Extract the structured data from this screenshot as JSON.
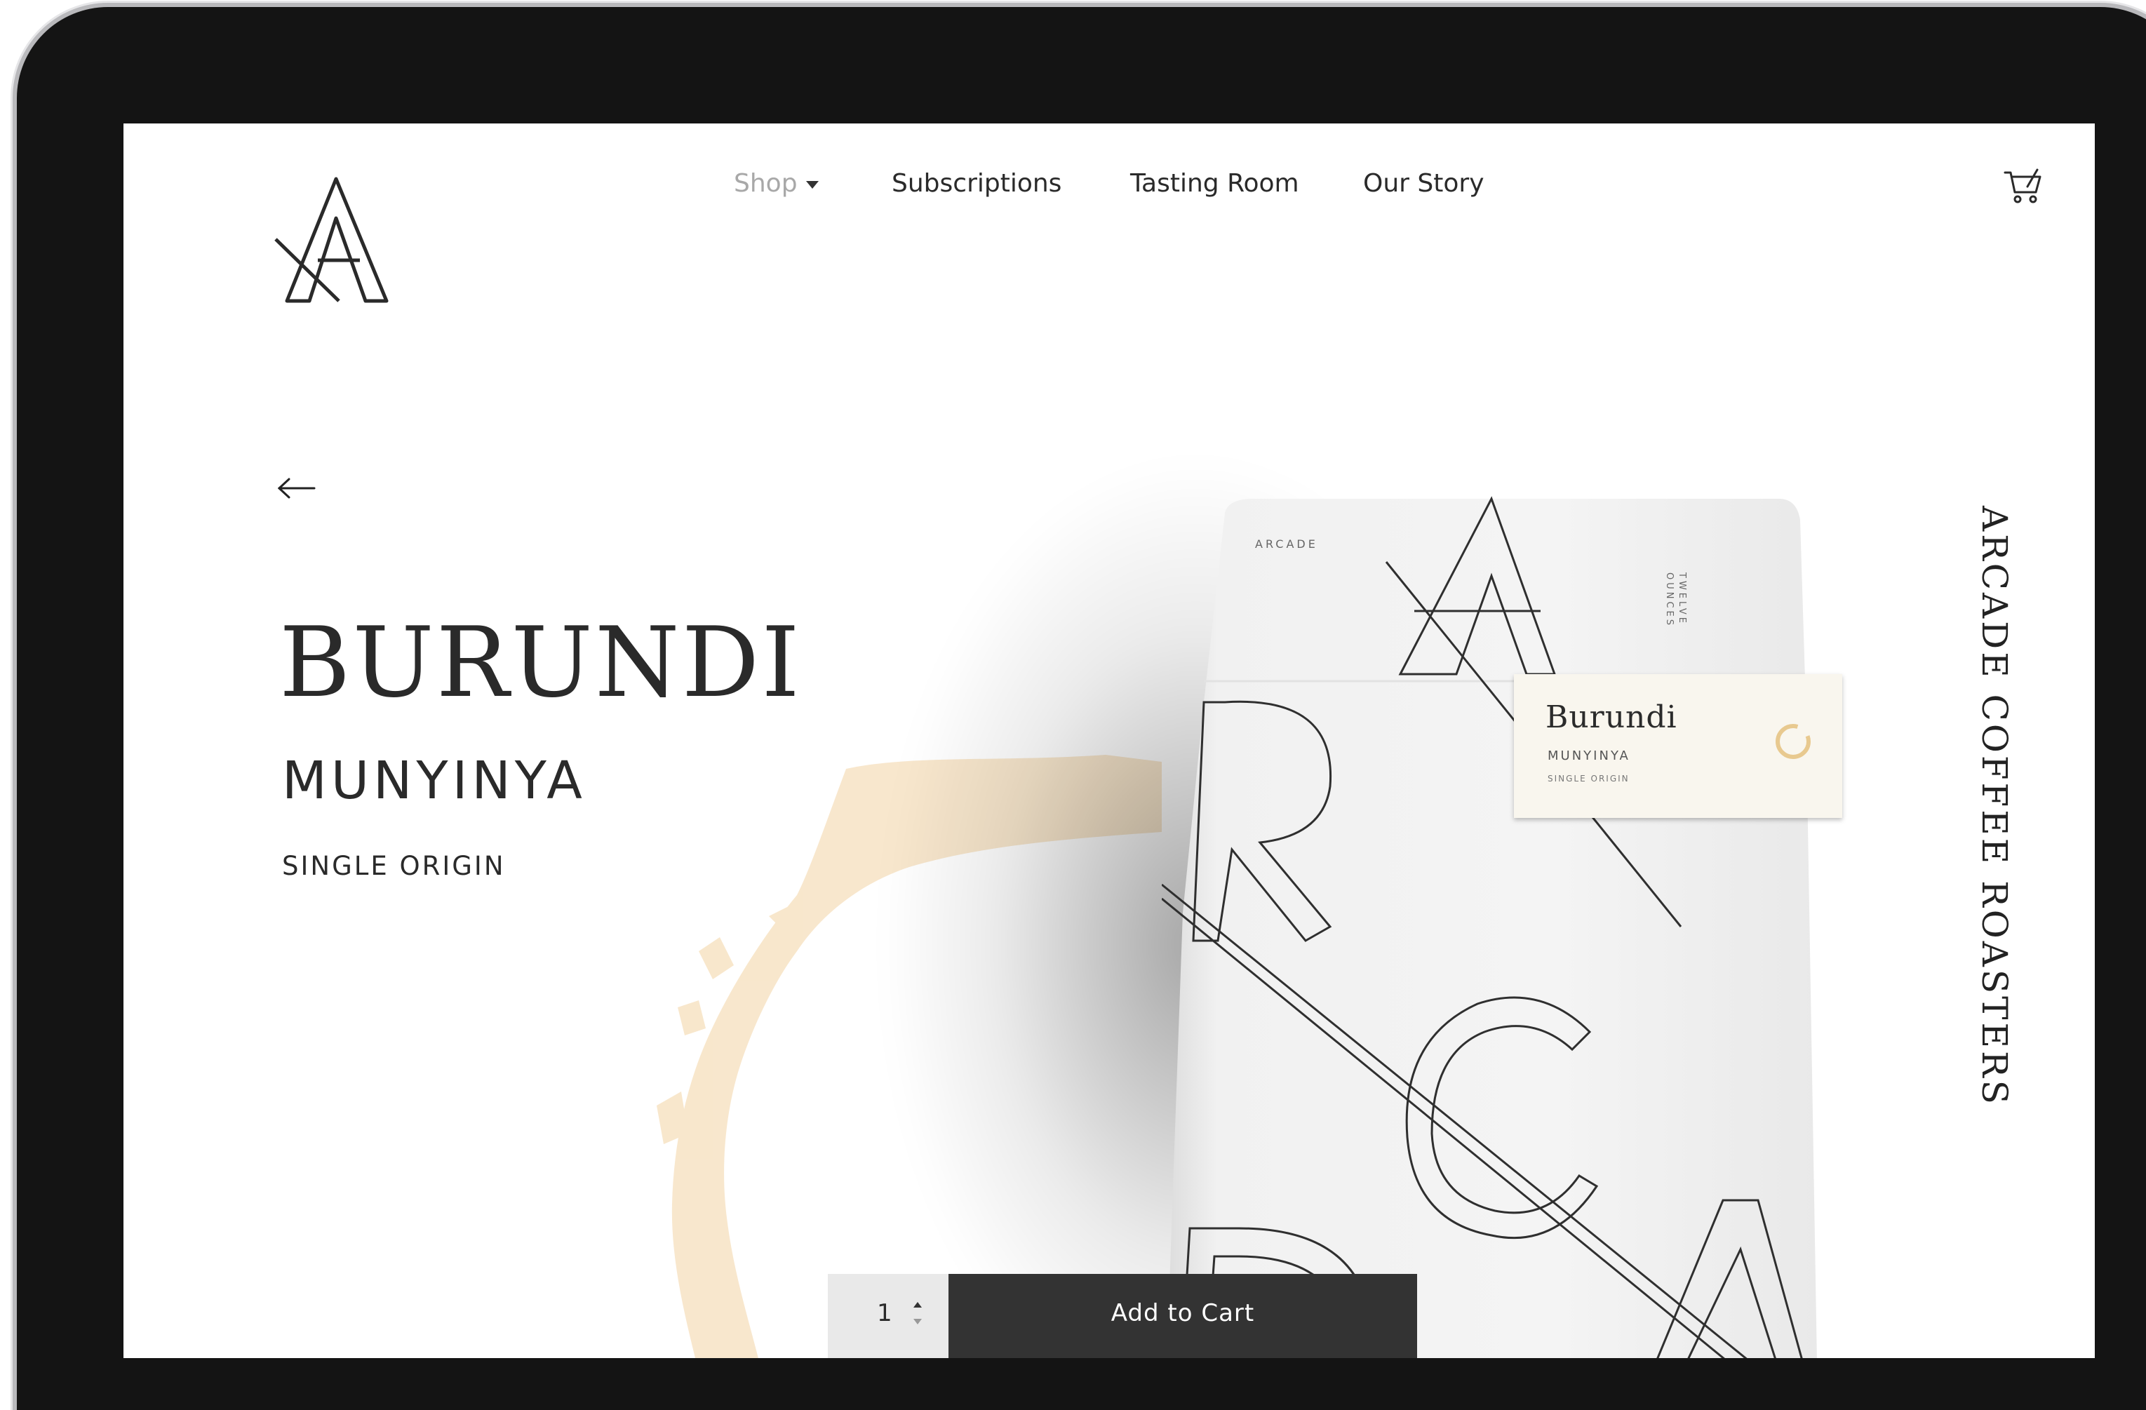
{
  "nav": {
    "items": [
      {
        "label": "Shop",
        "active": true
      },
      {
        "label": "Subscriptions"
      },
      {
        "label": "Tasting Room"
      },
      {
        "label": "Our Story"
      }
    ],
    "cart_icon": "cart-icon",
    "logo_icon": "arcade-a-logo"
  },
  "product": {
    "name": "BURUNDI",
    "farm": "MUNYINYA",
    "type": "SINGLE ORIGIN"
  },
  "bag": {
    "brand": "ARCADE",
    "size_line1": "TWELVE",
    "size_line2": "OUNCES",
    "label_name": "Burundi",
    "label_farm": "MUNYINYA",
    "label_type": "SINGLE ORIGIN"
  },
  "side_brand": "ARCADE COFFEE ROASTERS",
  "purchase": {
    "quantity": "1",
    "add_label": "Add to Cart"
  },
  "colors": {
    "accent_dark": "#333333",
    "splash": "#f7e3c4",
    "label_ring": "#e8c98f"
  }
}
